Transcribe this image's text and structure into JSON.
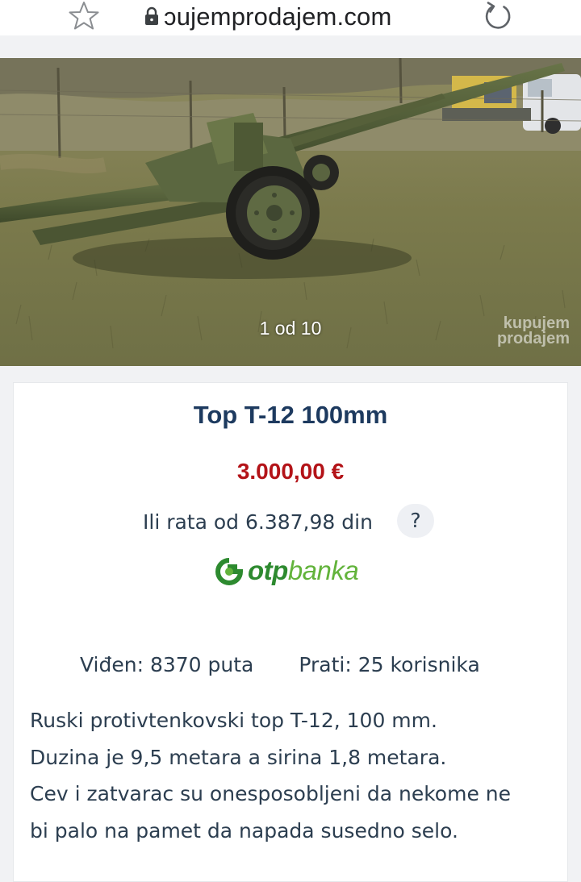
{
  "browser": {
    "url": "ɔujemprodajem.com"
  },
  "gallery": {
    "counter": "1 od 10",
    "watermark_line1": "kupujem",
    "watermark_line2": "prodajem"
  },
  "listing": {
    "title": "Top T-12 100mm",
    "price": "3.000,00 €",
    "installment": "Ili rata od 6.387,98 din",
    "help_label": "?",
    "bank_strong": "otp",
    "bank_light": "banka",
    "views": "Viđen: 8370 puta",
    "followers": "Prati: 25 korisnika",
    "description": [
      "Ruski protivtenkovski top T-12, 100 mm.",
      "Duzina je 9,5 metara a sirina 1,8 metara.",
      "Cev i zatvarac su onesposobljeni da nekome ne",
      "bi palo na pamet da napada susedno selo."
    ]
  },
  "colors": {
    "title": "#1d3a5f",
    "price": "#b31318",
    "otp_green": "#2d8a2f",
    "otp_light_green": "#62b33b"
  },
  "icons": [
    "star-icon",
    "lock-icon",
    "reload-icon",
    "otp-logo-icon"
  ]
}
